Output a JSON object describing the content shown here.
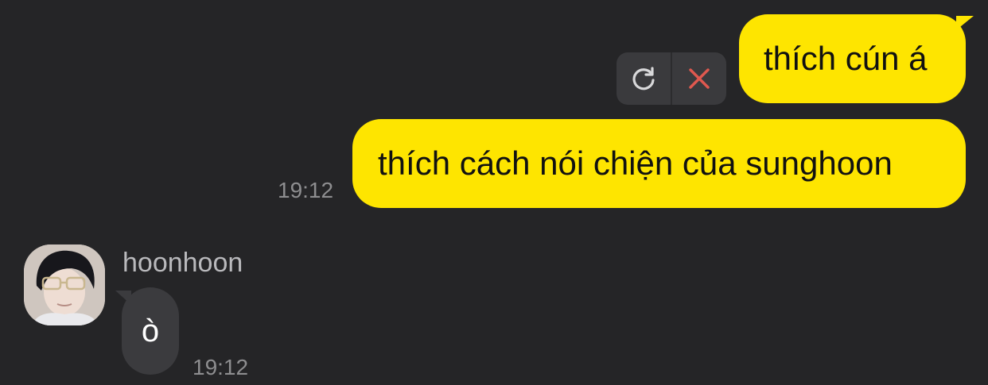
{
  "messages": {
    "outgoing": [
      {
        "text": "thích cún á"
      },
      {
        "text": "thích cách nói chiện của sunghoon",
        "time": "19:12"
      }
    ],
    "incoming": {
      "sender": "hoonhoon",
      "text": "ò",
      "time": "19:12"
    }
  },
  "failed_actions": {
    "retry_icon": "refresh-icon",
    "delete_icon": "close-icon",
    "delete_color": "#E0584F"
  },
  "colors": {
    "background": "#252527",
    "outgoing_bubble": "#FEE500",
    "incoming_bubble": "#3B3B3E"
  }
}
